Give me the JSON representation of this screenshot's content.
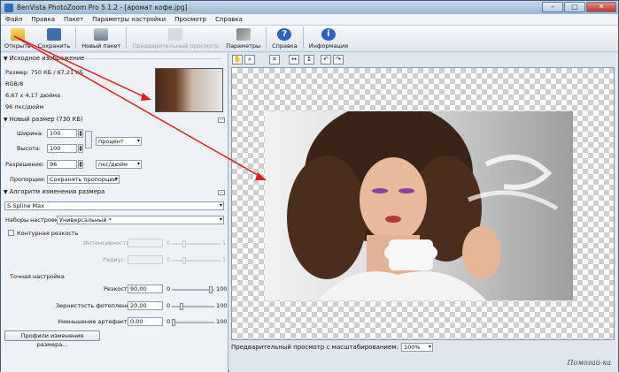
{
  "window": {
    "title": "BenVista PhotoZoom Pro 5.1.2 - [аромат кофе.jpg]",
    "min": "–",
    "max": "□",
    "close": "✕"
  },
  "menu": [
    "Файл",
    "Правка",
    "Пакет",
    "Параметры настройки",
    "Просмотр",
    "Справка"
  ],
  "toolbar": {
    "open": "Открыть",
    "save": "Сохранить",
    "batch": "Новый пакет",
    "preview": "Предварительный просмотр",
    "settings": "Параметры",
    "help": "Справка",
    "info": "Информация"
  },
  "source": {
    "header": "Исходное изображение",
    "size": "Размер: 750 КБ / 67,21 КБ",
    "mode": "RGB/8",
    "dims": "6,67 x 4,17 дюйма",
    "dpi": "96 пкс/дюйм"
  },
  "newsize": {
    "header": "Новый размер (730 КБ)",
    "width_label": "Ширина:",
    "width_value": "100",
    "height_label": "Высота:",
    "height_value": "100",
    "unit": "процент",
    "res_label": "Разрешение:",
    "res_value": "96",
    "res_unit": "пкс/дюйм",
    "prop_label": "Пропорции:",
    "prop_value": "Сохранять пропорции"
  },
  "algo": {
    "header": "Алгоритм изменения размера",
    "method": "S-Spline Max",
    "preset_label": "Наборы настроек:",
    "preset_value": "Универсальный *",
    "contour": "Контурная резкость",
    "intensity_label": "Интенсивность:",
    "radius_label": "Радиус:",
    "zero": "0",
    "one_a": "1",
    "one_b": "1"
  },
  "fine": {
    "header": "Точная настройка",
    "sharp_label": "Резкость:",
    "sharp_value": "90,00",
    "grain_label": "Зернистость фотопленки:",
    "grain_value": "20,00",
    "artifact_label": "Уменьшение артефактов:",
    "artifact_value": "0,00",
    "min": "0",
    "max": "100",
    "profiles": "Профили изменения размера..."
  },
  "preview": {
    "zoom_label": "Предварительный просмотр с масштабированием:",
    "zoom_value": "100%"
  },
  "watermark": "Помогай-ка"
}
